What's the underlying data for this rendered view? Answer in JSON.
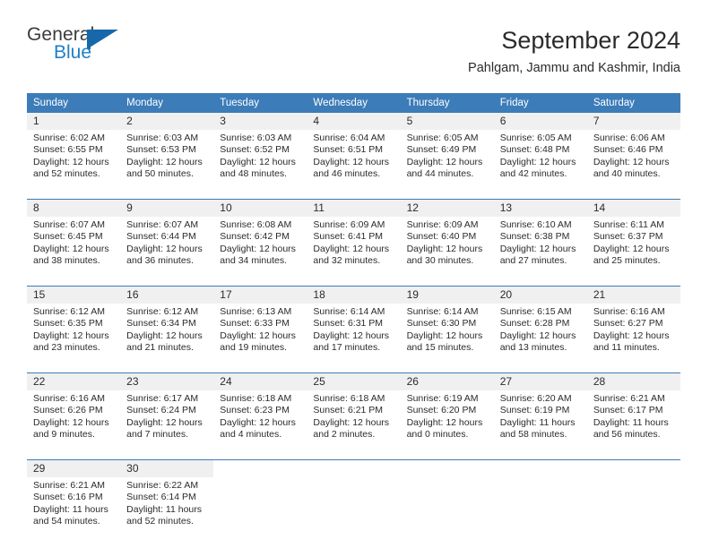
{
  "brand": {
    "word_one": "General",
    "word_two": "Blue",
    "logo_icon": "blue-triangle-logo"
  },
  "header": {
    "title": "September 2024",
    "location": "Pahlgam, Jammu and Kashmir, India"
  },
  "weekday_headers": [
    "Sunday",
    "Monday",
    "Tuesday",
    "Wednesday",
    "Thursday",
    "Friday",
    "Saturday"
  ],
  "colors": {
    "header_blue": "#3c7cb8",
    "daynum_band": "#f0f0f0",
    "brand_blue": "#1f7fc4",
    "text": "#2b2b2b"
  },
  "weeks": [
    [
      {
        "day": "1",
        "sunrise": "Sunrise: 6:02 AM",
        "sunset": "Sunset: 6:55 PM",
        "daylight1": "Daylight: 12 hours",
        "daylight2": "and 52 minutes."
      },
      {
        "day": "2",
        "sunrise": "Sunrise: 6:03 AM",
        "sunset": "Sunset: 6:53 PM",
        "daylight1": "Daylight: 12 hours",
        "daylight2": "and 50 minutes."
      },
      {
        "day": "3",
        "sunrise": "Sunrise: 6:03 AM",
        "sunset": "Sunset: 6:52 PM",
        "daylight1": "Daylight: 12 hours",
        "daylight2": "and 48 minutes."
      },
      {
        "day": "4",
        "sunrise": "Sunrise: 6:04 AM",
        "sunset": "Sunset: 6:51 PM",
        "daylight1": "Daylight: 12 hours",
        "daylight2": "and 46 minutes."
      },
      {
        "day": "5",
        "sunrise": "Sunrise: 6:05 AM",
        "sunset": "Sunset: 6:49 PM",
        "daylight1": "Daylight: 12 hours",
        "daylight2": "and 44 minutes."
      },
      {
        "day": "6",
        "sunrise": "Sunrise: 6:05 AM",
        "sunset": "Sunset: 6:48 PM",
        "daylight1": "Daylight: 12 hours",
        "daylight2": "and 42 minutes."
      },
      {
        "day": "7",
        "sunrise": "Sunrise: 6:06 AM",
        "sunset": "Sunset: 6:46 PM",
        "daylight1": "Daylight: 12 hours",
        "daylight2": "and 40 minutes."
      }
    ],
    [
      {
        "day": "8",
        "sunrise": "Sunrise: 6:07 AM",
        "sunset": "Sunset: 6:45 PM",
        "daylight1": "Daylight: 12 hours",
        "daylight2": "and 38 minutes."
      },
      {
        "day": "9",
        "sunrise": "Sunrise: 6:07 AM",
        "sunset": "Sunset: 6:44 PM",
        "daylight1": "Daylight: 12 hours",
        "daylight2": "and 36 minutes."
      },
      {
        "day": "10",
        "sunrise": "Sunrise: 6:08 AM",
        "sunset": "Sunset: 6:42 PM",
        "daylight1": "Daylight: 12 hours",
        "daylight2": "and 34 minutes."
      },
      {
        "day": "11",
        "sunrise": "Sunrise: 6:09 AM",
        "sunset": "Sunset: 6:41 PM",
        "daylight1": "Daylight: 12 hours",
        "daylight2": "and 32 minutes."
      },
      {
        "day": "12",
        "sunrise": "Sunrise: 6:09 AM",
        "sunset": "Sunset: 6:40 PM",
        "daylight1": "Daylight: 12 hours",
        "daylight2": "and 30 minutes."
      },
      {
        "day": "13",
        "sunrise": "Sunrise: 6:10 AM",
        "sunset": "Sunset: 6:38 PM",
        "daylight1": "Daylight: 12 hours",
        "daylight2": "and 27 minutes."
      },
      {
        "day": "14",
        "sunrise": "Sunrise: 6:11 AM",
        "sunset": "Sunset: 6:37 PM",
        "daylight1": "Daylight: 12 hours",
        "daylight2": "and 25 minutes."
      }
    ],
    [
      {
        "day": "15",
        "sunrise": "Sunrise: 6:12 AM",
        "sunset": "Sunset: 6:35 PM",
        "daylight1": "Daylight: 12 hours",
        "daylight2": "and 23 minutes."
      },
      {
        "day": "16",
        "sunrise": "Sunrise: 6:12 AM",
        "sunset": "Sunset: 6:34 PM",
        "daylight1": "Daylight: 12 hours",
        "daylight2": "and 21 minutes."
      },
      {
        "day": "17",
        "sunrise": "Sunrise: 6:13 AM",
        "sunset": "Sunset: 6:33 PM",
        "daylight1": "Daylight: 12 hours",
        "daylight2": "and 19 minutes."
      },
      {
        "day": "18",
        "sunrise": "Sunrise: 6:14 AM",
        "sunset": "Sunset: 6:31 PM",
        "daylight1": "Daylight: 12 hours",
        "daylight2": "and 17 minutes."
      },
      {
        "day": "19",
        "sunrise": "Sunrise: 6:14 AM",
        "sunset": "Sunset: 6:30 PM",
        "daylight1": "Daylight: 12 hours",
        "daylight2": "and 15 minutes."
      },
      {
        "day": "20",
        "sunrise": "Sunrise: 6:15 AM",
        "sunset": "Sunset: 6:28 PM",
        "daylight1": "Daylight: 12 hours",
        "daylight2": "and 13 minutes."
      },
      {
        "day": "21",
        "sunrise": "Sunrise: 6:16 AM",
        "sunset": "Sunset: 6:27 PM",
        "daylight1": "Daylight: 12 hours",
        "daylight2": "and 11 minutes."
      }
    ],
    [
      {
        "day": "22",
        "sunrise": "Sunrise: 6:16 AM",
        "sunset": "Sunset: 6:26 PM",
        "daylight1": "Daylight: 12 hours",
        "daylight2": "and 9 minutes."
      },
      {
        "day": "23",
        "sunrise": "Sunrise: 6:17 AM",
        "sunset": "Sunset: 6:24 PM",
        "daylight1": "Daylight: 12 hours",
        "daylight2": "and 7 minutes."
      },
      {
        "day": "24",
        "sunrise": "Sunrise: 6:18 AM",
        "sunset": "Sunset: 6:23 PM",
        "daylight1": "Daylight: 12 hours",
        "daylight2": "and 4 minutes."
      },
      {
        "day": "25",
        "sunrise": "Sunrise: 6:18 AM",
        "sunset": "Sunset: 6:21 PM",
        "daylight1": "Daylight: 12 hours",
        "daylight2": "and 2 minutes."
      },
      {
        "day": "26",
        "sunrise": "Sunrise: 6:19 AM",
        "sunset": "Sunset: 6:20 PM",
        "daylight1": "Daylight: 12 hours",
        "daylight2": "and 0 minutes."
      },
      {
        "day": "27",
        "sunrise": "Sunrise: 6:20 AM",
        "sunset": "Sunset: 6:19 PM",
        "daylight1": "Daylight: 11 hours",
        "daylight2": "and 58 minutes."
      },
      {
        "day": "28",
        "sunrise": "Sunrise: 6:21 AM",
        "sunset": "Sunset: 6:17 PM",
        "daylight1": "Daylight: 11 hours",
        "daylight2": "and 56 minutes."
      }
    ],
    [
      {
        "day": "29",
        "sunrise": "Sunrise: 6:21 AM",
        "sunset": "Sunset: 6:16 PM",
        "daylight1": "Daylight: 11 hours",
        "daylight2": "and 54 minutes."
      },
      {
        "day": "30",
        "sunrise": "Sunrise: 6:22 AM",
        "sunset": "Sunset: 6:14 PM",
        "daylight1": "Daylight: 11 hours",
        "daylight2": "and 52 minutes."
      },
      {
        "day": "",
        "sunrise": "",
        "sunset": "",
        "daylight1": "",
        "daylight2": ""
      },
      {
        "day": "",
        "sunrise": "",
        "sunset": "",
        "daylight1": "",
        "daylight2": ""
      },
      {
        "day": "",
        "sunrise": "",
        "sunset": "",
        "daylight1": "",
        "daylight2": ""
      },
      {
        "day": "",
        "sunrise": "",
        "sunset": "",
        "daylight1": "",
        "daylight2": ""
      },
      {
        "day": "",
        "sunrise": "",
        "sunset": "",
        "daylight1": "",
        "daylight2": ""
      }
    ]
  ]
}
